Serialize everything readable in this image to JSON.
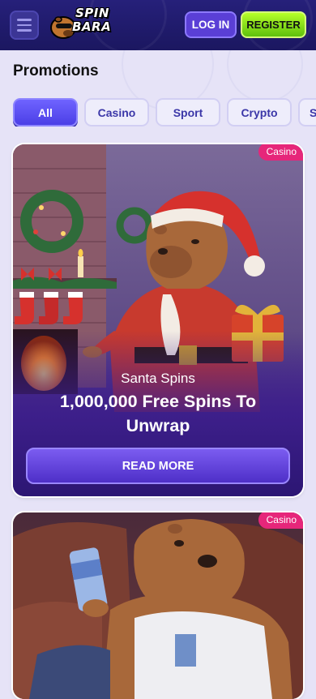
{
  "header": {
    "logo_text_line1": "SPIN",
    "logo_text_line2": "BARA",
    "login_label": "LOG IN",
    "register_label": "REGISTER"
  },
  "page": {
    "title": "Promotions"
  },
  "tabs": [
    {
      "label": "All",
      "active": true
    },
    {
      "label": "Casino",
      "active": false
    },
    {
      "label": "Sport",
      "active": false
    },
    {
      "label": "Crypto",
      "active": false
    },
    {
      "label": "S",
      "active": false
    }
  ],
  "promotions": [
    {
      "badge": "Casino",
      "subtitle": "Santa Spins",
      "title_line1": "1,000,000 Free Spins To",
      "title_line2": "Unwrap",
      "button_label": "READ MORE"
    },
    {
      "badge": "Casino"
    }
  ],
  "colors": {
    "header_bg": "#1b1760",
    "accent_purple": "#5a3fd6",
    "register_green": "#7bd61a",
    "badge_pink": "#e6267a",
    "page_bg": "#e6e3f7"
  }
}
